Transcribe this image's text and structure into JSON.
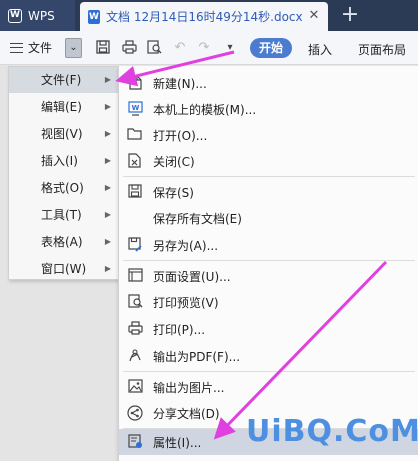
{
  "tabs": {
    "app_name": "WPS",
    "app_logo": "W",
    "doc_title": "文档 12月14日16时49分14秒.docx",
    "doc_icon": "W"
  },
  "toolbar": {
    "file_label": "文件",
    "start_label": "开始",
    "insert_label": "插入",
    "layout_label": "页面布局"
  },
  "main_menu": {
    "items": [
      {
        "label": "文件(F)",
        "active": true
      },
      {
        "label": "编辑(E)"
      },
      {
        "label": "视图(V)"
      },
      {
        "label": "插入(I)"
      },
      {
        "label": "格式(O)"
      },
      {
        "label": "工具(T)"
      },
      {
        "label": "表格(A)"
      },
      {
        "label": "窗口(W)"
      }
    ]
  },
  "sub_menu": {
    "items": [
      {
        "label": "新建(N)...",
        "icon": "new-document-icon"
      },
      {
        "label": "本机上的模板(M)...",
        "icon": "template-icon"
      },
      {
        "label": "打开(O)...",
        "icon": "folder-open-icon"
      },
      {
        "label": "关闭(C)",
        "icon": "close-document-icon"
      },
      {
        "label": "保存(S)",
        "icon": "save-icon"
      },
      {
        "label": "保存所有文档(E)",
        "icon": ""
      },
      {
        "label": "另存为(A)...",
        "icon": "save-as-icon"
      },
      {
        "label": "页面设置(U)...",
        "icon": "page-setup-icon"
      },
      {
        "label": "打印预览(V)",
        "icon": "print-preview-icon"
      },
      {
        "label": "打印(P)...",
        "icon": "printer-icon"
      },
      {
        "label": "输出为PDF(F)...",
        "icon": "export-pdf-icon"
      },
      {
        "label": "输出为图片...",
        "icon": "export-image-icon"
      },
      {
        "label": "分享文档(D)",
        "icon": "share-icon"
      },
      {
        "label": "属性(I)...",
        "icon": "properties-icon",
        "highlighted": true
      }
    ]
  },
  "watermark": "UiBQ.CoM",
  "colors": {
    "tabbar": "#2b3a55",
    "accent": "#4b7ccf",
    "arrow": "#e040e0",
    "watermark": "#4d8fe0"
  }
}
